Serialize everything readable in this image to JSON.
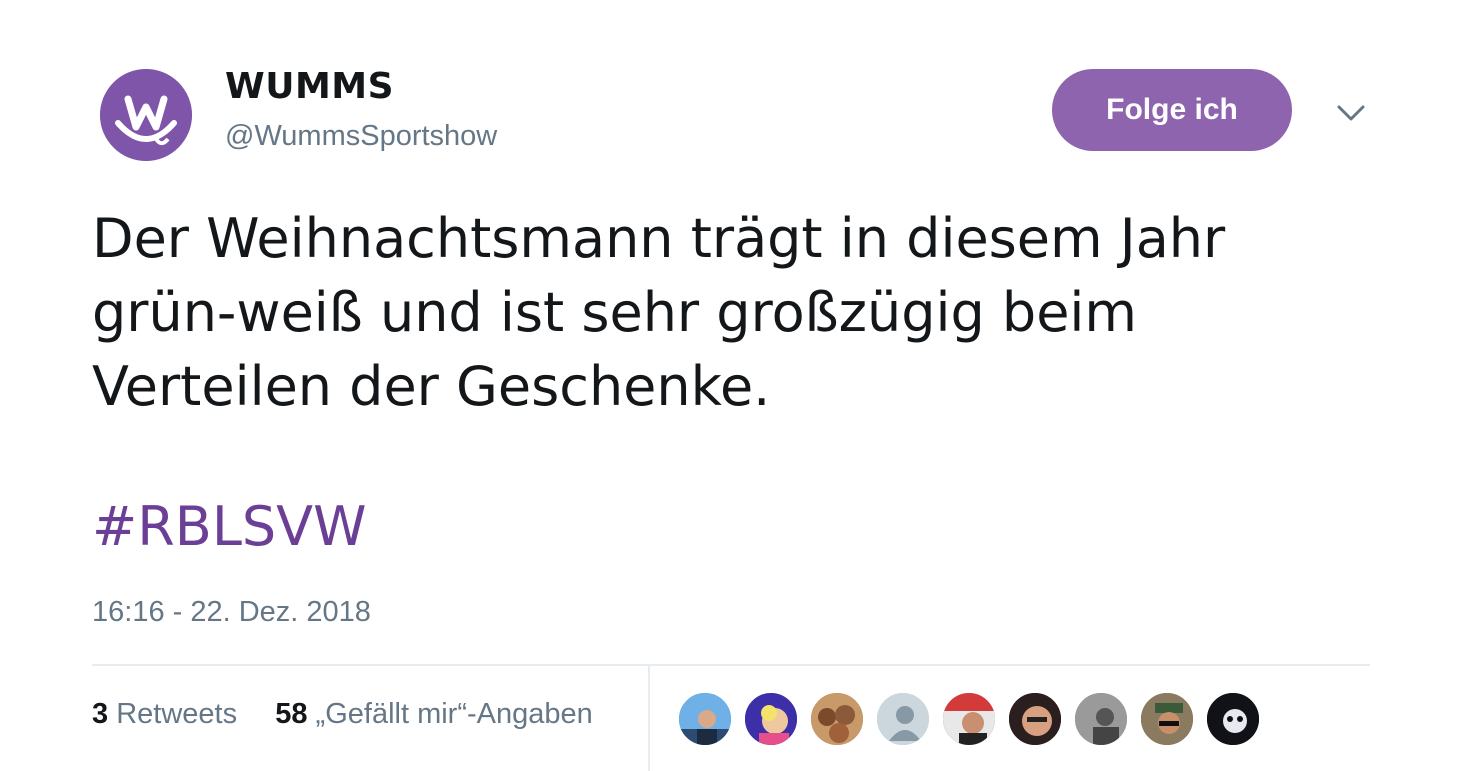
{
  "user": {
    "name": "WUMMS",
    "handle": "@WummsSportshow",
    "avatar_icon": "wumms-logo-icon",
    "brand_color": "#7e55a8"
  },
  "follow_button": {
    "label": "Folge ich",
    "color": "#8d64ad"
  },
  "menu": {
    "icon": "chevron-down-icon"
  },
  "tweet": {
    "lines": [
      "Der Weihnachtsmann trägt in diesem Jahr",
      "grün-weiß und ist sehr großzügig beim",
      "Verteilen der Geschenke."
    ],
    "hashtag": "#RBLSVW",
    "hashtag_color": "#6c3f97",
    "timestamp": "16:16 - 22. Dez. 2018"
  },
  "stats": {
    "retweets_count": "3",
    "retweets_label": "Retweets",
    "likes_count": "58",
    "likes_label": "„Gefällt mir“-Angaben"
  },
  "likers": [
    {
      "icon": "user-avatar-icon",
      "color": "#3b82c4"
    },
    {
      "icon": "user-avatar-icon",
      "color": "#4a3fbf"
    },
    {
      "icon": "user-avatar-icon",
      "color": "#b07a4a"
    },
    {
      "icon": "default-avatar-icon",
      "color": "#ccd6dd"
    },
    {
      "icon": "user-avatar-icon",
      "color": "#d33a3a"
    },
    {
      "icon": "user-avatar-icon",
      "color": "#3a2a2a"
    },
    {
      "icon": "user-avatar-icon",
      "color": "#8a8a8a"
    },
    {
      "icon": "user-avatar-icon",
      "color": "#7a6650"
    },
    {
      "icon": "user-avatar-icon",
      "color": "#15151f"
    }
  ]
}
